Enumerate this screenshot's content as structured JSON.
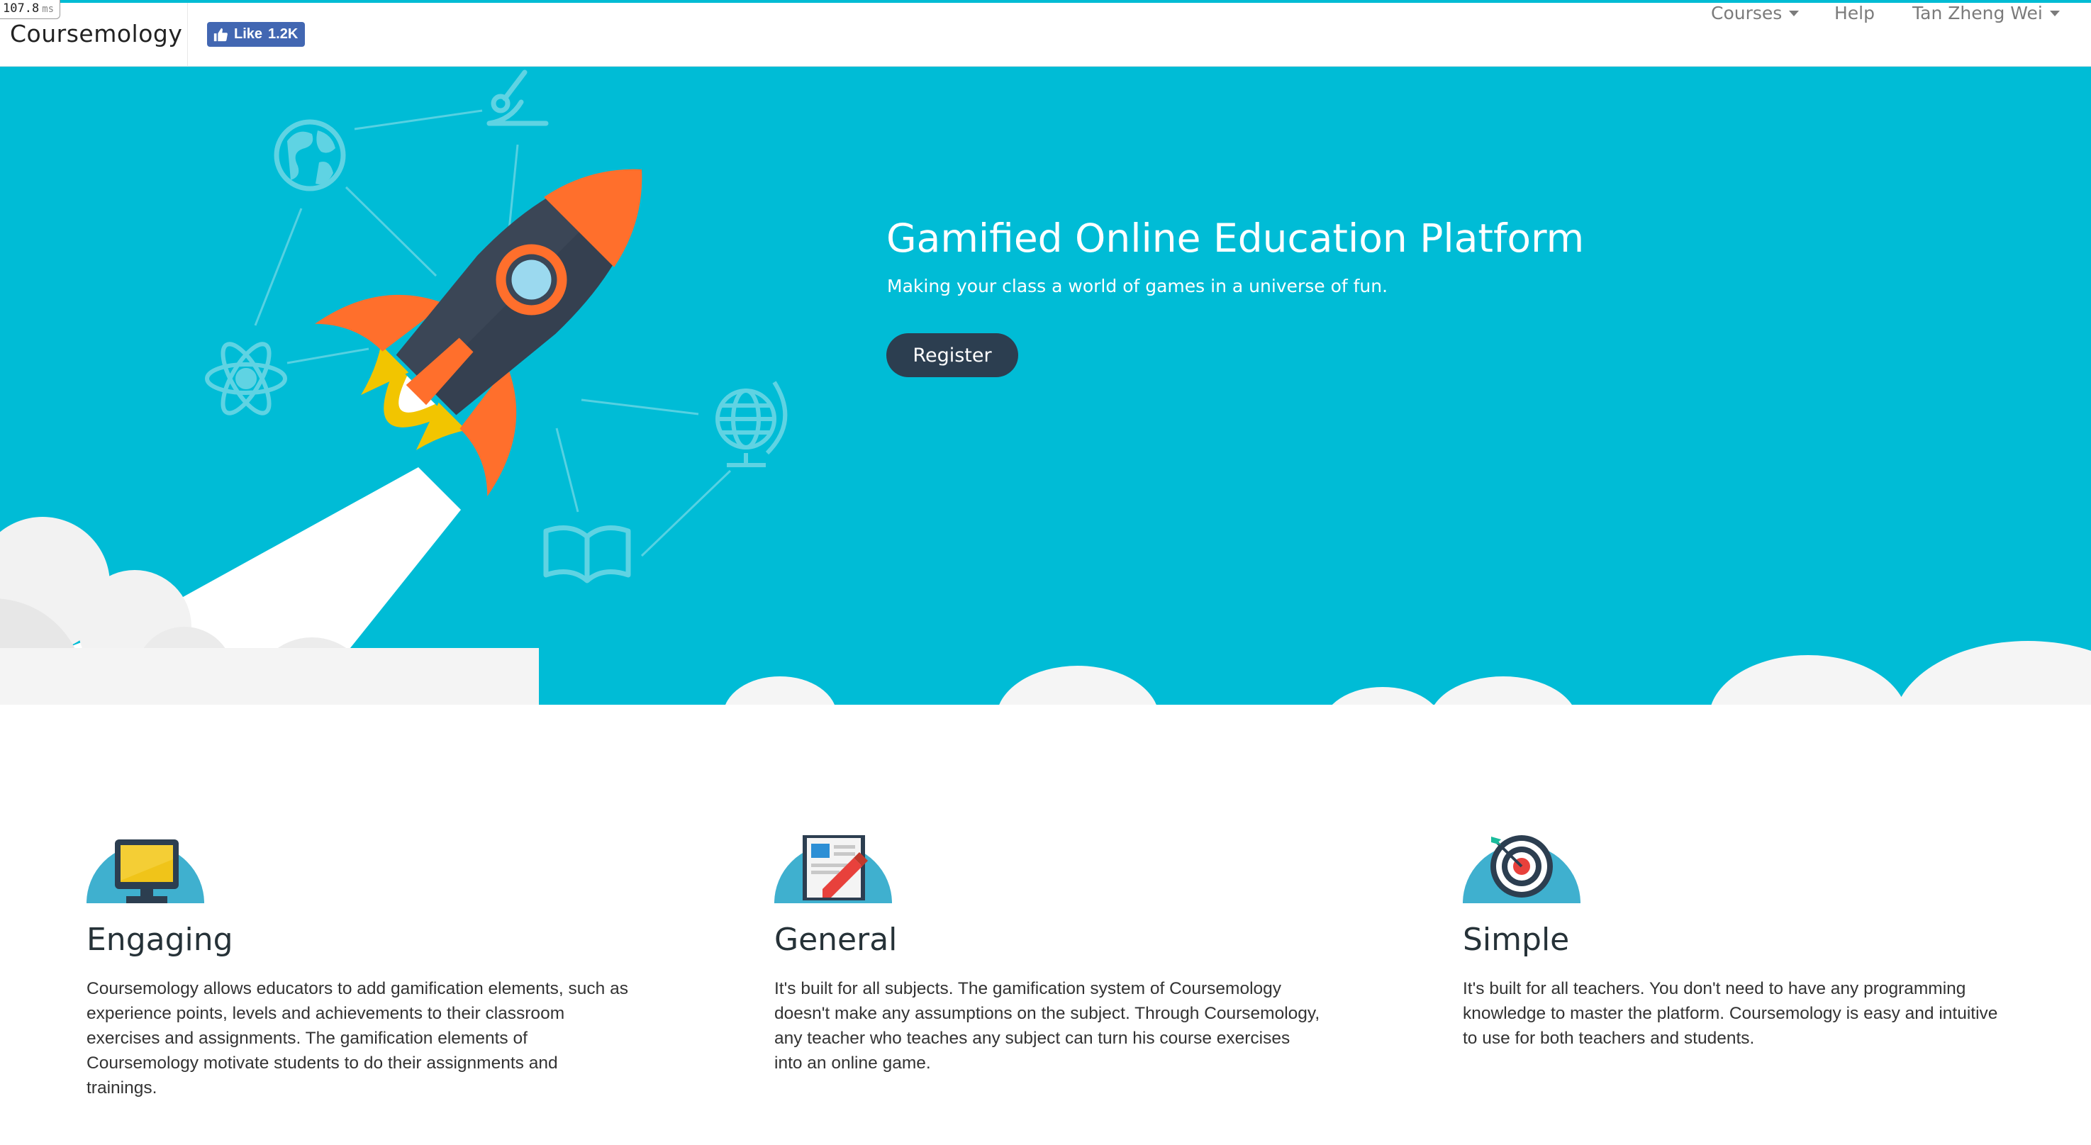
{
  "timing": {
    "value": "107.8",
    "unit": "ms"
  },
  "navbar": {
    "brand": "Coursemology",
    "fb_like": {
      "label": "Like",
      "count": "1.2K"
    },
    "courses_label": "Courses",
    "help_label": "Help",
    "user_label": "Tan Zheng Wei"
  },
  "hero": {
    "title": "Gamified Online Education Platform",
    "subtitle": "Making your class a world of games in a universe of fun.",
    "register_label": "Register",
    "icons": [
      "microscope-icon",
      "globe-icon",
      "atom-icon",
      "desk-globe-icon",
      "book-icon",
      "rocket-icon"
    ]
  },
  "features": [
    {
      "icon": "computer-monitor-icon",
      "title": "Engaging",
      "text": "Coursemology allows educators to add gamification elements, such as experience points, levels and achievements to their classroom exercises and assignments. The gamification elements of Coursemology motivate students to do their assignments and trainings."
    },
    {
      "icon": "newspaper-pencil-icon",
      "title": "General",
      "text": "It's built for all subjects. The gamification system of Coursemology doesn't make any assumptions on the subject. Through Coursemology, any teacher who teaches any subject can turn his course exercises into an online game."
    },
    {
      "icon": "target-dart-icon",
      "title": "Simple",
      "text": "It's built for all teachers. You don't need to have any programming knowledge to master the platform. Coursemology is easy and intuitive to use for both teachers and students."
    }
  ],
  "colors": {
    "hero_bg": "#00bcd6",
    "button_bg": "#2c3e50",
    "rocket_orange": "#ff6f2c",
    "rocket_body": "#3b4656",
    "flame_yellow": "#f2c500",
    "fb_blue": "#4267b2"
  }
}
